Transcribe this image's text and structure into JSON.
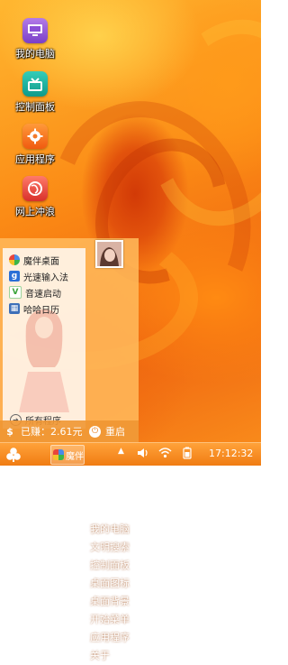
{
  "desktop": {
    "icons": [
      {
        "label": "我的电脑",
        "icon": "computer-icon"
      },
      {
        "label": "控制面板",
        "icon": "control-panel-icon"
      },
      {
        "label": "应用程序",
        "icon": "gear-icon"
      },
      {
        "label": "网上冲浪",
        "icon": "globe-icon"
      }
    ]
  },
  "start_menu": {
    "programs": [
      {
        "label": "魔伴桌面",
        "icon": "pinwheel-icon"
      },
      {
        "label": "光速输入法",
        "icon": "input-method-icon"
      },
      {
        "label": "音速启动",
        "icon": "launcher-icon"
      },
      {
        "label": "哈哈日历",
        "icon": "calendar-icon"
      }
    ],
    "all_programs": "所有程序",
    "links": [
      "我的电脑",
      "文明搜索",
      "控制面板",
      "桌面图标",
      "桌面背景",
      "开始菜单",
      "应用程序",
      "关于"
    ],
    "earned": "已赚：2.61元",
    "restart": "重启"
  },
  "taskbar": {
    "app_label": "魔伴",
    "clock": "17:12:32"
  },
  "colors": {
    "accent": "#f08a1c",
    "menu_bg": "#ffb85a"
  }
}
